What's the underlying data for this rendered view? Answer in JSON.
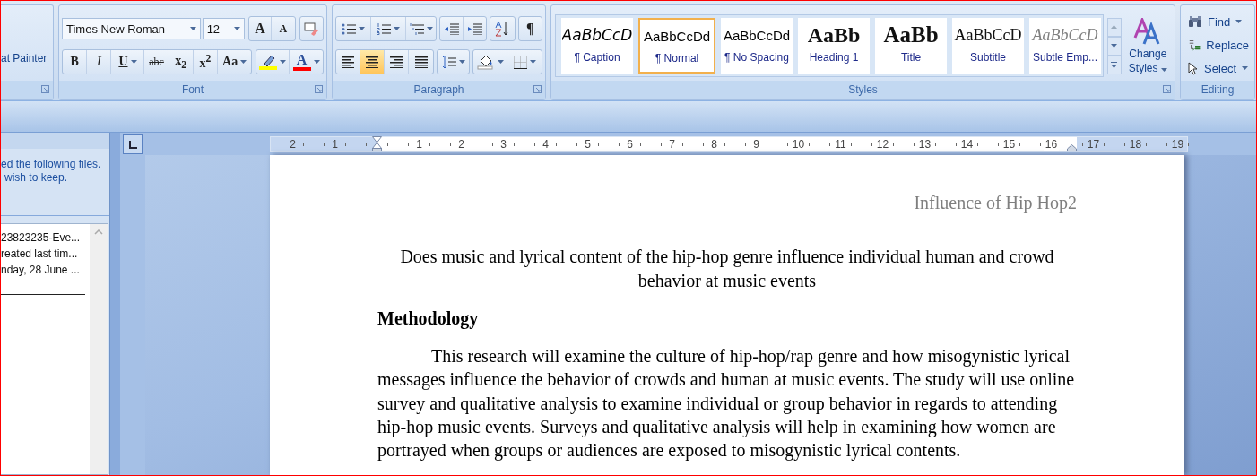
{
  "ribbon": {
    "clipboard": {
      "format_painter": "at Painter"
    },
    "font": {
      "label": "Font",
      "font_name": "Times New Roman",
      "font_size": "12",
      "size_buttons": [
        {
          "kind": "grow",
          "label": "A"
        },
        {
          "kind": "shrink",
          "label": "A"
        }
      ],
      "format_buttons": [
        {
          "kind": "bold",
          "label": "B"
        },
        {
          "kind": "italic",
          "label": "I"
        },
        {
          "kind": "underline",
          "label": "U"
        },
        {
          "kind": "strike",
          "label": "abc"
        },
        {
          "kind": "sub",
          "label": "x$_{2}$"
        },
        {
          "kind": "sup",
          "label": "x$^{2}$"
        },
        {
          "kind": "case",
          "label": "Aa"
        }
      ],
      "highlight": {
        "color": "#ffff00"
      },
      "font_color": {
        "label": "A",
        "color": "#ff0000"
      }
    },
    "paragraph": {
      "label": "Paragraph",
      "pilcrow": "¶",
      "alignment": [
        {
          "kind": "left",
          "selected": false
        },
        {
          "kind": "center",
          "selected": true
        },
        {
          "kind": "right",
          "selected": false
        },
        {
          "kind": "justify",
          "selected": false
        }
      ]
    },
    "styles": {
      "label": "Styles",
      "change_styles": "Change Styles",
      "items": [
        {
          "kind": "caption",
          "preview": "AaBbCcD",
          "name": "¶ Caption",
          "selected": false
        },
        {
          "kind": "normal",
          "preview": "AaBbCcDd",
          "name": "¶ Normal",
          "selected": true
        },
        {
          "kind": "nospacing",
          "preview": "AaBbCcDd",
          "name": "¶ No Spacing",
          "selected": false
        },
        {
          "kind": "heading",
          "preview": "AaBb",
          "name": "Heading 1",
          "selected": false
        },
        {
          "kind": "title",
          "preview": "AaBb",
          "name": "Title",
          "selected": false
        },
        {
          "kind": "subtitle",
          "preview": "AaBbCcD",
          "name": "Subtitle",
          "selected": false
        },
        {
          "kind": "subtle",
          "preview": "AaBbCcD",
          "name": "Subtle Emp...",
          "selected": false
        }
      ]
    },
    "editing": {
      "label": "Editing",
      "items": [
        {
          "kind": "find",
          "label": "Find"
        },
        {
          "kind": "replace",
          "label": "Replace"
        },
        {
          "kind": "select",
          "label": "Select"
        }
      ]
    }
  },
  "recovery_pane": {
    "message_lines": [
      "ed the following files.",
      "wish to keep."
    ],
    "files": [
      "23823235-Eve...",
      "reated last tim...",
      "nday, 28 June ..."
    ]
  },
  "ruler": {
    "left_numbers": [
      "2",
      "1"
    ],
    "numbers": [
      "1",
      "2",
      "3",
      "4",
      "5",
      "6",
      "7",
      "8",
      "9",
      "10",
      "11",
      "12",
      "13",
      "14",
      "15",
      "16",
      "17",
      "18",
      "19"
    ]
  },
  "document": {
    "header": "Influence of Hip Hop2",
    "title": "Does music and lyrical content of the hip-hop genre influence individual human and crowd behavior at music events",
    "heading": "Methodology",
    "paragraph": "This research will examine the culture of hip-hop/rap genre and how misogynistic lyrical messages influence the behavior of crowds and human at music events. The study will use online survey and qualitative analysis to examine individual or group behavior in regards to attending hip-hop music events. Surveys and qualitative analysis will help in examining how women are portrayed when groups or audiences are exposed to misogynistic lyrical contents."
  }
}
